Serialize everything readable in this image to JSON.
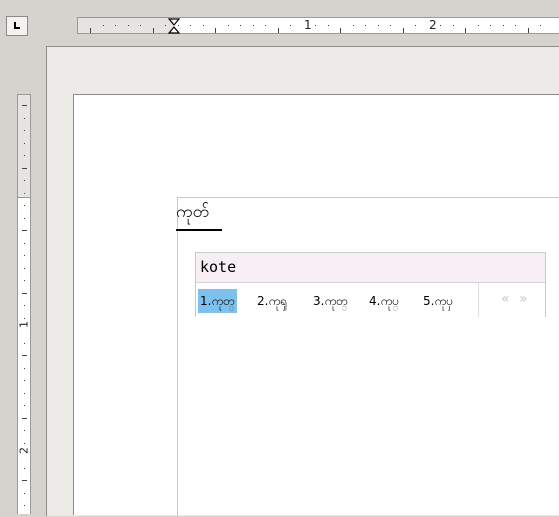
{
  "ruler_horizontal": {
    "labels": [
      "1",
      "2"
    ]
  },
  "ruler_vertical": {
    "labels": [
      "1",
      "2"
    ]
  },
  "document": {
    "typed_text": "ကုတ်"
  },
  "ime": {
    "preedit": "kote",
    "candidates": [
      "1.ကုတ္",
      "2.ကုၡ",
      "3.ကုတ္",
      "4.ကုပ္",
      "5.ကုၦ"
    ],
    "selected_index": 0,
    "prev_label": "«",
    "next_label": "»"
  },
  "colors": {
    "selection": "#7ec1ee",
    "popup_bg": "#f7eff4"
  }
}
